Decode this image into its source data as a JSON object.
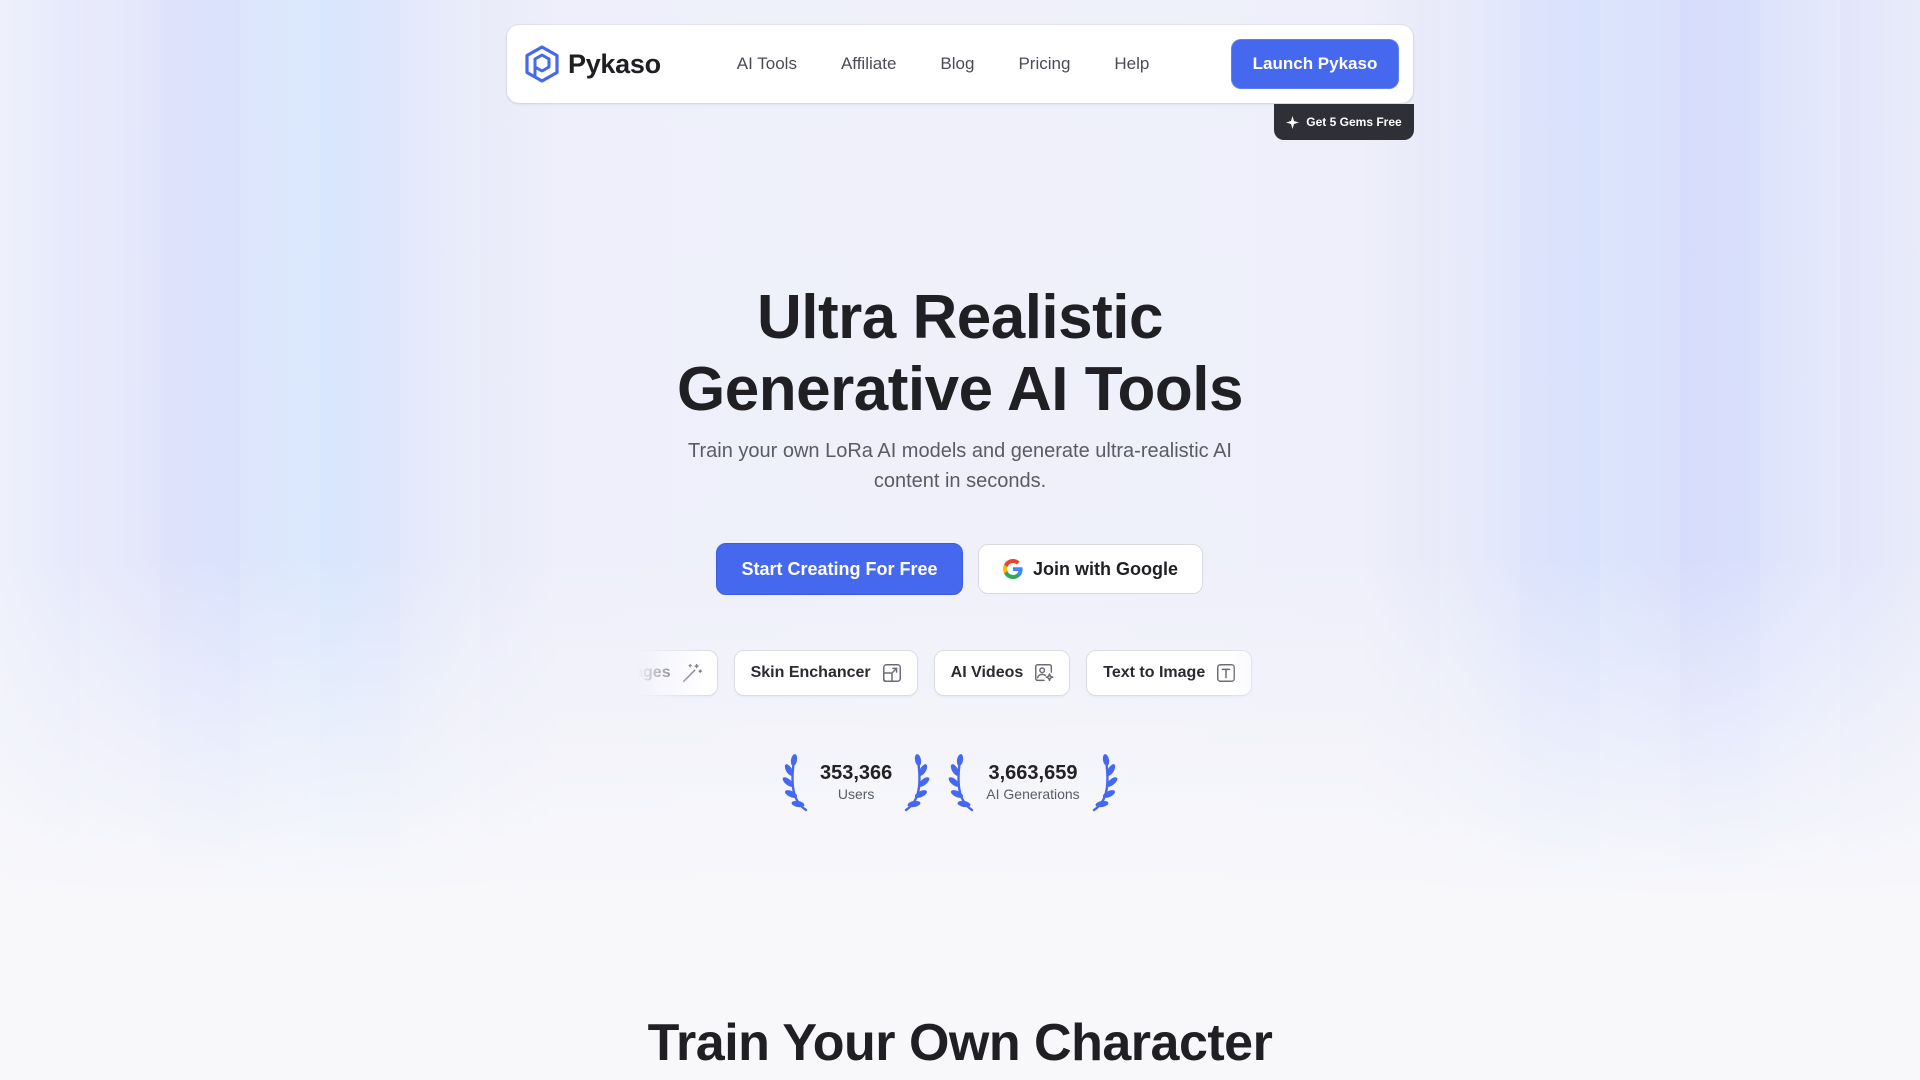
{
  "brand": {
    "name": "Pykaso",
    "accent": "#4568ee"
  },
  "nav": {
    "items": [
      {
        "label": "AI Tools"
      },
      {
        "label": "Affiliate"
      },
      {
        "label": "Blog"
      },
      {
        "label": "Pricing"
      },
      {
        "label": "Help"
      }
    ],
    "launch_label": "Launch Pykaso",
    "gems_label": "Get 5 Gems Free"
  },
  "hero": {
    "title_line1": "Ultra Realistic",
    "title_line2": "Generative AI Tools",
    "subtitle": "Train your own LoRa AI models and generate ultra-realistic AI content in seconds.",
    "cta_primary": "Start Creating For Free",
    "cta_google": "Join with Google"
  },
  "tools": [
    {
      "label": "AI Images",
      "icon": "magic-wand-icon"
    },
    {
      "label": "Skin Enchancer",
      "icon": "upscale-icon"
    },
    {
      "label": "AI Videos",
      "icon": "video-sparkle-icon"
    },
    {
      "label": "Text to Image",
      "icon": "text-box-icon"
    }
  ],
  "stats": [
    {
      "value": "353,366",
      "label": "Users"
    },
    {
      "value": "3,663,659",
      "label": "AI Generations"
    }
  ],
  "section": {
    "title": "Train Your Own Character"
  }
}
